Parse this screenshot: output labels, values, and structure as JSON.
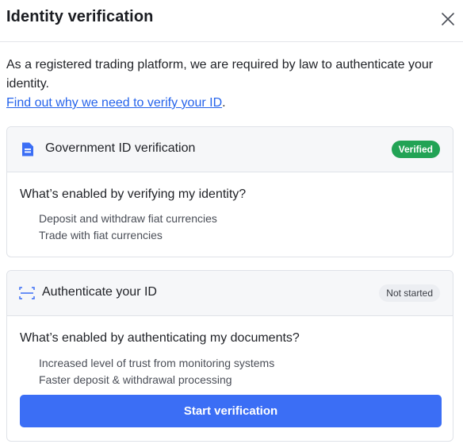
{
  "dialog": {
    "title": "Identity verification",
    "close_icon": "close-icon"
  },
  "intro": {
    "text": "As a registered trading platform, we are required by law to authenticate your identity.",
    "link_text": "Find out why we need to verify your ID",
    "trailing": "."
  },
  "cards": [
    {
      "icon": "document-icon",
      "title": "Government ID verification",
      "status": "Verified",
      "question": "What’s enabled by verifying my identity?",
      "benefits": [
        "Deposit and withdraw fiat currencies",
        "Trade with fiat currencies"
      ]
    },
    {
      "icon": "scan-icon",
      "title": "Authenticate your ID",
      "status": "Not started",
      "question": "What’s enabled by authenticating my documents?",
      "benefits": [
        "Increased level of trust from monitoring systems",
        "Faster deposit & withdrawal processing"
      ],
      "button_label": "Start verification"
    }
  ],
  "colors": {
    "accent": "#3b6ef5",
    "link": "#2563eb",
    "verified": "#22a355"
  }
}
